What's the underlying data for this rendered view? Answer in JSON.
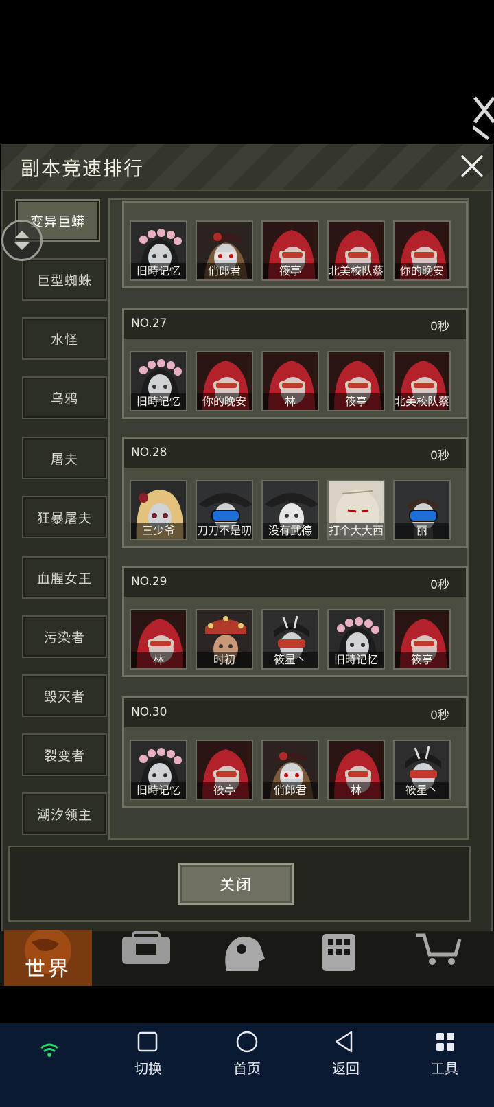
{
  "dialog": {
    "title": "副本竞速排行",
    "close_button_label": "关闭"
  },
  "tabs": [
    {
      "label": "变异巨蟒",
      "active": true
    },
    {
      "label": "巨型蜘蛛"
    },
    {
      "label": "水怪"
    },
    {
      "label": "乌鸦"
    },
    {
      "label": "屠夫"
    },
    {
      "label": "狂暴屠夫"
    },
    {
      "label": "血腥女王"
    },
    {
      "label": "污染者"
    },
    {
      "label": "毁灭者"
    },
    {
      "label": "裂变者"
    },
    {
      "label": "潮汐领主"
    }
  ],
  "rankings": [
    {
      "players": [
        {
          "name": "旧時记忆",
          "avatar": "flower-crown-avatar"
        },
        {
          "name": "俏郎君",
          "avatar": "masked-hat-avatar"
        },
        {
          "name": "筱亭",
          "avatar": "red-hood-avatar"
        },
        {
          "name": "北美校队蔡",
          "avatar": "red-hood-avatar"
        },
        {
          "name": "你的晚安",
          "avatar": "red-hood-avatar"
        }
      ]
    },
    {
      "rank": "NO.27",
      "time": "0秒",
      "players": [
        {
          "name": "旧時记忆",
          "avatar": "flower-crown-avatar"
        },
        {
          "name": "你的晚安",
          "avatar": "red-hood-avatar"
        },
        {
          "name": "林",
          "avatar": "red-hood-avatar"
        },
        {
          "name": "筱亭",
          "avatar": "red-hood-avatar"
        },
        {
          "name": "北美校队蔡",
          "avatar": "red-hood-avatar"
        }
      ]
    },
    {
      "rank": "NO.28",
      "time": "0秒",
      "players": [
        {
          "name": "三少爷",
          "avatar": "blonde-avatar"
        },
        {
          "name": "刀刀不是叨",
          "avatar": "pirate-goggles-avatar"
        },
        {
          "name": "没有武德",
          "avatar": "pirate-mask-avatar"
        },
        {
          "name": "打个大大西",
          "avatar": "sack-head-avatar"
        },
        {
          "name": "丽",
          "avatar": "goggles-avatar"
        }
      ]
    },
    {
      "rank": "NO.29",
      "time": "0秒",
      "players": [
        {
          "name": "林",
          "avatar": "red-hood-avatar"
        },
        {
          "name": "时初",
          "avatar": "opera-avatar"
        },
        {
          "name": "筱星丶",
          "avatar": "headband-avatar"
        },
        {
          "name": "旧時记忆",
          "avatar": "flower-crown-avatar"
        },
        {
          "name": "筱亭",
          "avatar": "red-hood-avatar"
        }
      ]
    },
    {
      "rank": "NO.30",
      "time": "0秒",
      "players": [
        {
          "name": "旧時记忆",
          "avatar": "flower-crown-avatar"
        },
        {
          "name": "筱亭",
          "avatar": "red-hood-avatar"
        },
        {
          "name": "俏郎君",
          "avatar": "masked-hat-avatar"
        },
        {
          "name": "林",
          "avatar": "red-hood-avatar"
        },
        {
          "name": "筱星丶",
          "avatar": "headband-avatar"
        }
      ]
    }
  ],
  "game_nav": {
    "world_label": "世界",
    "icons": [
      "backpack-icon",
      "head-gear-icon",
      "building-icon",
      "cart-icon"
    ]
  },
  "android_nav": {
    "switch_label": "切换",
    "home_label": "首页",
    "back_label": "返回",
    "tools_label": "工具"
  },
  "colors": {
    "dialog_bg": "#2b2e25",
    "red_hood": "#b3222a",
    "android_nav_bg": "#0a1a33"
  }
}
